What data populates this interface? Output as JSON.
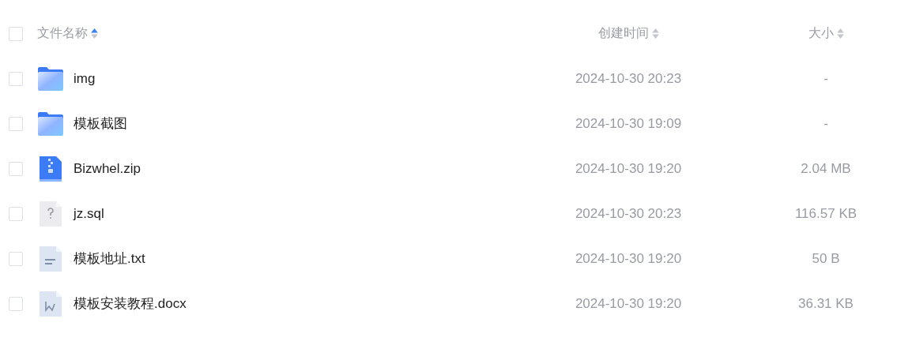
{
  "header": {
    "checked": false,
    "columns": [
      {
        "label": "文件名称",
        "sorted_ascending": true
      },
      {
        "label": "创建时间",
        "sorted_ascending": false
      },
      {
        "label": "大小",
        "sorted_ascending": false
      }
    ]
  },
  "rows": [
    {
      "kind": "folder",
      "name": "img",
      "created": "2024-10-30 20:23",
      "size": "-",
      "checked": false
    },
    {
      "kind": "folder",
      "name": "模板截图",
      "created": "2024-10-30 19:09",
      "size": "-",
      "checked": false
    },
    {
      "kind": "zip",
      "name": "Bizwhel.zip",
      "created": "2024-10-30 19:20",
      "size": "2.04 MB",
      "checked": false
    },
    {
      "kind": "unknown",
      "name": "jz.sql",
      "created": "2024-10-30 20:23",
      "size": "116.57 KB",
      "checked": false
    },
    {
      "kind": "text",
      "name": "模板地址.txt",
      "created": "2024-10-30 19:20",
      "size": "50 B",
      "checked": false
    },
    {
      "kind": "word",
      "name": "模板安装教程.docx",
      "created": "2024-10-30 19:20",
      "size": "36.31 KB",
      "checked": false
    }
  ]
}
